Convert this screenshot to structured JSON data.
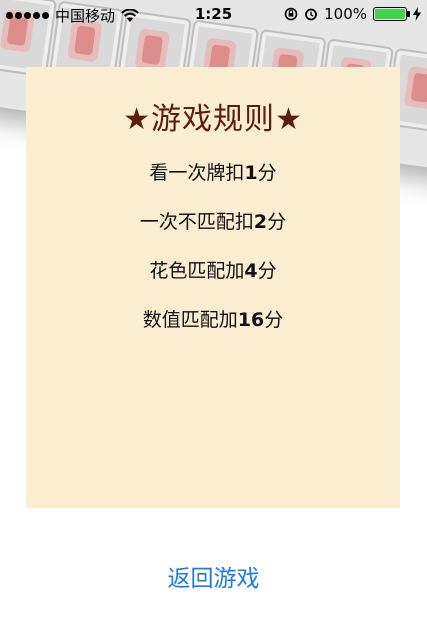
{
  "status_bar": {
    "carrier": "中国移动",
    "time": "1:25",
    "battery_percent_label": "100%",
    "battery_level": 1.0,
    "icons": [
      "signal-dots-icon",
      "wifi-icon",
      "rotation-lock-icon",
      "alarm-icon",
      "battery-icon",
      "charging-icon"
    ]
  },
  "rules": {
    "title": "★游戏规则★",
    "items": [
      {
        "prefix": "看一次牌扣",
        "value": "1",
        "suffix": "分"
      },
      {
        "prefix": "一次不匹配扣",
        "value": "2",
        "suffix": "分"
      },
      {
        "prefix": "花色匹配加",
        "value": "4",
        "suffix": "分"
      },
      {
        "prefix": "数值匹配加",
        "value": "16",
        "suffix": "分"
      }
    ]
  },
  "actions": {
    "return_label": "返回游戏"
  },
  "colors": {
    "panel_background": "#faedd0",
    "title": "#5c1d0a",
    "link": "#1e7be0",
    "battery": "#3fd44a"
  }
}
